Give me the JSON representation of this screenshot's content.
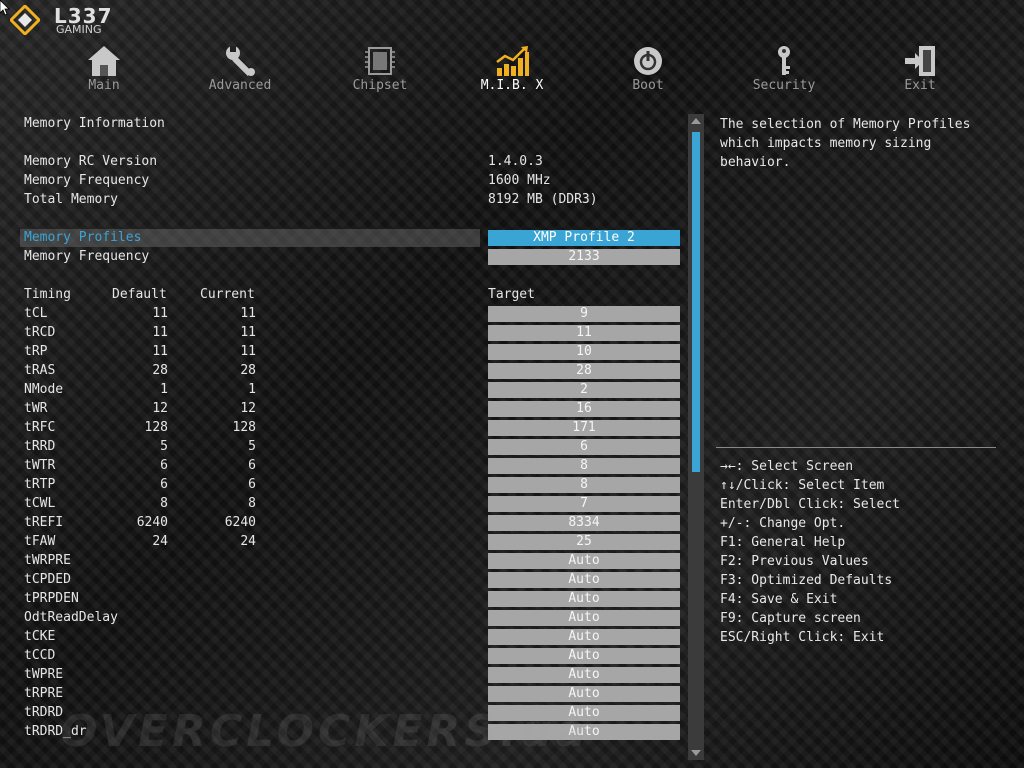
{
  "logo": {
    "brand": "L337",
    "sub": "GAMING"
  },
  "tabs": [
    {
      "label": "Main",
      "icon": "home-icon",
      "active": false
    },
    {
      "label": "Advanced",
      "icon": "wrench-icon",
      "active": false
    },
    {
      "label": "Chipset",
      "icon": "chip-icon",
      "active": false
    },
    {
      "label": "M.I.B. X",
      "icon": "chart-icon",
      "active": true
    },
    {
      "label": "Boot",
      "icon": "power-icon",
      "active": false
    },
    {
      "label": "Security",
      "icon": "key-icon",
      "active": false
    },
    {
      "label": "Exit",
      "icon": "exit-icon",
      "active": false
    }
  ],
  "memory": {
    "heading": "Memory Information",
    "rc_label": "Memory RC Version",
    "rc_value": "1.4.0.3",
    "freq_label": "Memory Frequency",
    "freq_value": "1600 MHz",
    "total_label": "Total Memory",
    "total_value": "8192 MB (DDR3)",
    "profiles_label": "Memory Profiles",
    "profiles_value": "XMP Profile 2",
    "freq2_label": "Memory Frequency",
    "freq2_value": "2133"
  },
  "timing_header": {
    "timing": "Timing",
    "default": "Default",
    "current": "Current",
    "target": "Target"
  },
  "timings": [
    {
      "name": "tCL",
      "default": "11",
      "current": "11",
      "target": "9"
    },
    {
      "name": "tRCD",
      "default": "11",
      "current": "11",
      "target": "11"
    },
    {
      "name": "tRP",
      "default": "11",
      "current": "11",
      "target": "10"
    },
    {
      "name": "tRAS",
      "default": "28",
      "current": "28",
      "target": "28"
    },
    {
      "name": "NMode",
      "default": "1",
      "current": "1",
      "target": "2"
    },
    {
      "name": "tWR",
      "default": "12",
      "current": "12",
      "target": "16"
    },
    {
      "name": "tRFC",
      "default": "128",
      "current": "128",
      "target": "171"
    },
    {
      "name": "tRRD",
      "default": "5",
      "current": "5",
      "target": "6"
    },
    {
      "name": "tWTR",
      "default": "6",
      "current": "6",
      "target": "8"
    },
    {
      "name": "tRTP",
      "default": "6",
      "current": "6",
      "target": "8"
    },
    {
      "name": "tCWL",
      "default": "8",
      "current": "8",
      "target": "7"
    },
    {
      "name": "tREFI",
      "default": "6240",
      "current": "6240",
      "target": "8334"
    },
    {
      "name": "tFAW",
      "default": "24",
      "current": "24",
      "target": "25"
    },
    {
      "name": "tWRPRE",
      "default": "",
      "current": "",
      "target": "Auto"
    },
    {
      "name": "tCPDED",
      "default": "",
      "current": "",
      "target": "Auto"
    },
    {
      "name": "tPRPDEN",
      "default": "",
      "current": "",
      "target": "Auto"
    },
    {
      "name": "OdtReadDelay",
      "default": "",
      "current": "",
      "target": "Auto"
    },
    {
      "name": "tCKE",
      "default": "",
      "current": "",
      "target": "Auto"
    },
    {
      "name": "tCCD",
      "default": "",
      "current": "",
      "target": "Auto"
    },
    {
      "name": "tWPRE",
      "default": "",
      "current": "",
      "target": "Auto"
    },
    {
      "name": "tRPRE",
      "default": "",
      "current": "",
      "target": "Auto"
    },
    {
      "name": "tRDRD",
      "default": "",
      "current": "",
      "target": "Auto"
    },
    {
      "name": "tRDRD_dr",
      "default": "",
      "current": "",
      "target": "Auto"
    }
  ],
  "help": {
    "description": [
      "The selection of Memory Profiles",
      "which impacts memory sizing",
      "behavior."
    ],
    "keys": [
      "→←: Select Screen",
      "↑↓/Click: Select Item",
      "Enter/Dbl Click: Select",
      "+/-: Change Opt.",
      "F1: General Help",
      "F2: Previous Values",
      "F3: Optimized Defaults",
      "F4: Save & Exit",
      "F9: Capture screen",
      "ESC/Right Click: Exit"
    ]
  },
  "watermark": "OVERCLOCKERS.ua",
  "colors": {
    "accent": "#3aa5d4",
    "field": "#a6a6a6",
    "logo_gold": "#f0b020"
  }
}
